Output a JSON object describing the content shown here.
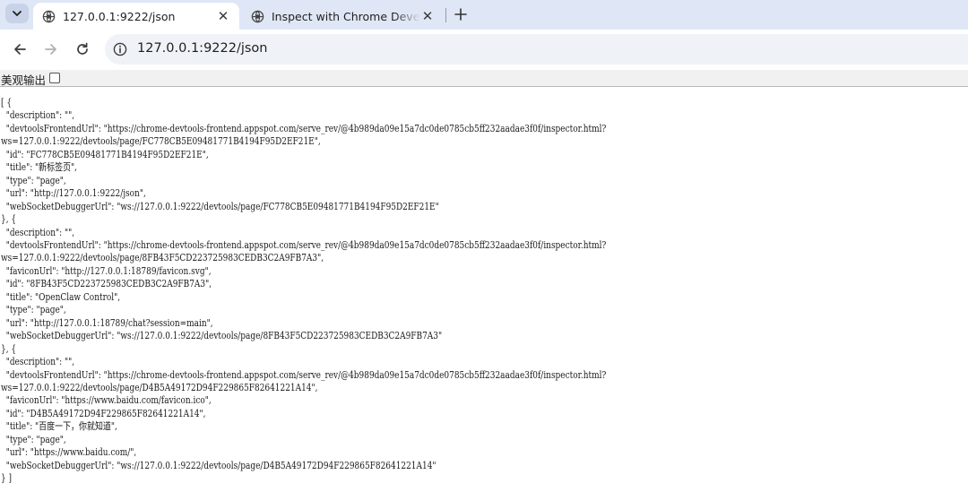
{
  "tabs": [
    {
      "title": "127.0.0.1:9222/json",
      "active": true,
      "icon": "globe-icon"
    },
    {
      "title": "Inspect with Chrome Developer Tools",
      "active": false,
      "icon": "globe-icon"
    }
  ],
  "toolbar": {
    "url": "127.0.0.1:9222/json",
    "info_icon": "info-icon"
  },
  "pretty_print": {
    "label": "美观输出",
    "checked": false
  },
  "json_lines": [
    "[ {",
    "  \"description\": \"\",",
    "  \"devtoolsFrontendUrl\": \"https://chrome-devtools-frontend.appspot.com/serve_rev/@4b989da09e15a7dc0de0785cb5ff232aadae3f0f/inspector.html?",
    "ws=127.0.0.1:9222/devtools/page/FC778CB5E09481771B4194F95D2EF21E\",",
    "  \"id\": \"FC778CB5E09481771B4194F95D2EF21E\",",
    "  \"title\": \"新标签页\",",
    "  \"type\": \"page\",",
    "  \"url\": \"http://127.0.0.1:9222/json\",",
    "  \"webSocketDebuggerUrl\": \"ws://127.0.0.1:9222/devtools/page/FC778CB5E09481771B4194F95D2EF21E\"",
    "}, {",
    "  \"description\": \"\",",
    "  \"devtoolsFrontendUrl\": \"https://chrome-devtools-frontend.appspot.com/serve_rev/@4b989da09e15a7dc0de0785cb5ff232aadae3f0f/inspector.html?",
    "ws=127.0.0.1:9222/devtools/page/8FB43F5CD223725983CEDB3C2A9FB7A3\",",
    "  \"faviconUrl\": \"http://127.0.0.1:18789/favicon.svg\",",
    "  \"id\": \"8FB43F5CD223725983CEDB3C2A9FB7A3\",",
    "  \"title\": \"OpenClaw Control\",",
    "  \"type\": \"page\",",
    "  \"url\": \"http://127.0.0.1:18789/chat?session=main\",",
    "  \"webSocketDebuggerUrl\": \"ws://127.0.0.1:9222/devtools/page/8FB43F5CD223725983CEDB3C2A9FB7A3\"",
    "}, {",
    "  \"description\": \"\",",
    "  \"devtoolsFrontendUrl\": \"https://chrome-devtools-frontend.appspot.com/serve_rev/@4b989da09e15a7dc0de0785cb5ff232aadae3f0f/inspector.html?",
    "ws=127.0.0.1:9222/devtools/page/D4B5A49172D94F229865F82641221A14\",",
    "  \"faviconUrl\": \"https://www.baidu.com/favicon.ico\",",
    "  \"id\": \"D4B5A49172D94F229865F82641221A14\",",
    "  \"title\": \"百度一下，你就知道\",",
    "  \"type\": \"page\",",
    "  \"url\": \"https://www.baidu.com/\",",
    "  \"webSocketDebuggerUrl\": \"ws://127.0.0.1:9222/devtools/page/D4B5A49172D94F229865F82641221A14\"",
    "} ]"
  ],
  "colors": {
    "tabstrip_bg": "#dfe7f6",
    "omnibox_bg": "#eff2f7",
    "text": "#1a1a1a"
  }
}
